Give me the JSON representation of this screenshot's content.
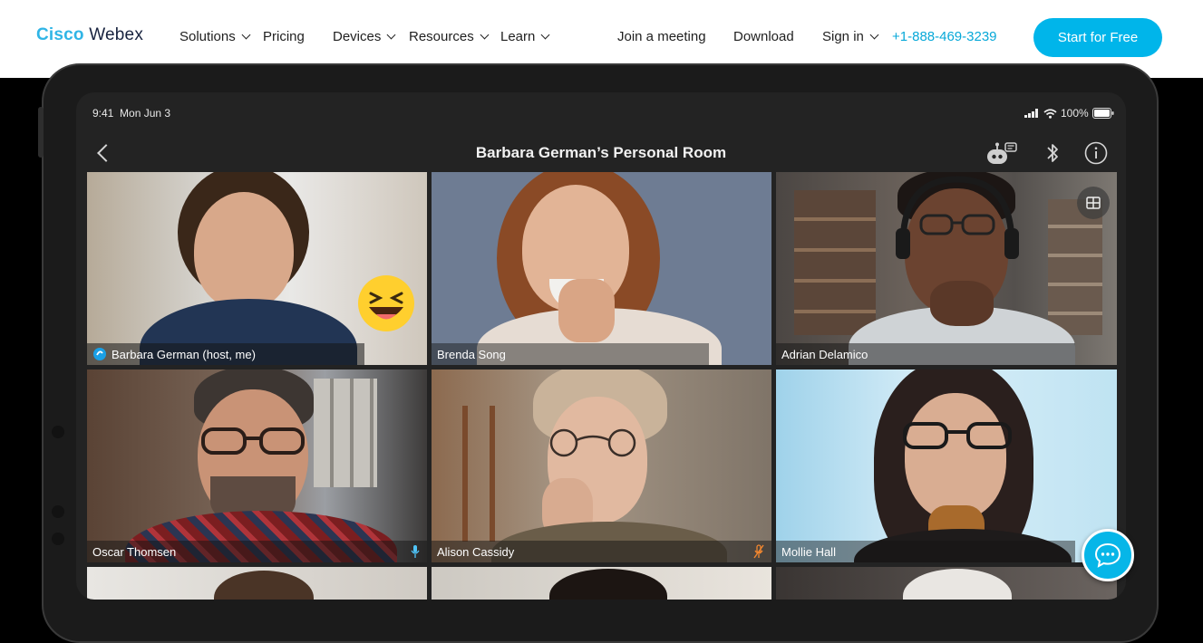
{
  "nav": {
    "logo_cisco": "Cisco",
    "logo_webex": "Webex",
    "items": [
      "Solutions",
      "Pricing",
      "Devices",
      "Resources",
      "Learn"
    ],
    "join": "Join a meeting",
    "download": "Download",
    "signin": "Sign in",
    "phone": "+1-888-469-3239",
    "cta": "Start for Free"
  },
  "device": {
    "time": "9:41",
    "date": "Mon Jun 3",
    "battery": "100%",
    "room_title": "Barbara German’s Personal Room",
    "participants": [
      "Barbara German (host, me)",
      "Brenda Song",
      "Adrian Delamico",
      "Oscar Thomsen",
      "Alison Cassidy",
      "Mollie Hall"
    ]
  },
  "icons": {
    "back": "chevron-left-icon",
    "assistant": "robot-icon",
    "bluetooth": "bluetooth-icon",
    "info": "info-icon",
    "layout": "grid-layout-icon",
    "chat": "chat-bubble-icon",
    "reaction": "laughing-emoji-icon"
  },
  "colors": {
    "brand": "#30b5e6",
    "cta": "#00b5ea",
    "active_speaker": "#1e9ad6"
  }
}
